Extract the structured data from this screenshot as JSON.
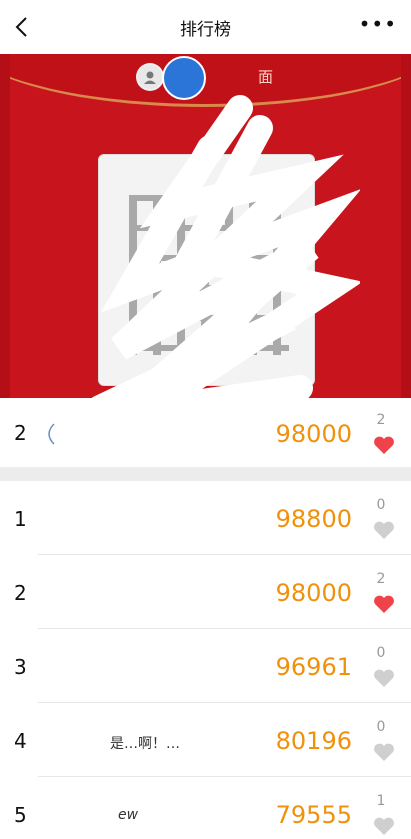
{
  "topbar": {
    "title": "排行榜"
  },
  "banner": {
    "caption": "面"
  },
  "colors": {
    "score": "#f0910e",
    "banner_red": "#c8141c",
    "heart_active": "#f0424a",
    "heart_inactive": "#cfcfcf"
  },
  "my_rank": {
    "rank": "2",
    "score": "98000",
    "likes": "2",
    "liked": true
  },
  "rows": [
    {
      "rank": "1",
      "name": "",
      "score": "98800",
      "likes": "0",
      "liked": false
    },
    {
      "rank": "2",
      "name": "",
      "score": "98000",
      "likes": "2",
      "liked": true
    },
    {
      "rank": "3",
      "name": "",
      "score": "96961",
      "likes": "0",
      "liked": false
    },
    {
      "rank": "4",
      "name": "是…啊！…",
      "score": "80196",
      "likes": "0",
      "liked": false
    },
    {
      "rank": "5",
      "name": "ew",
      "score": "79555",
      "likes": "1",
      "liked": false
    }
  ]
}
